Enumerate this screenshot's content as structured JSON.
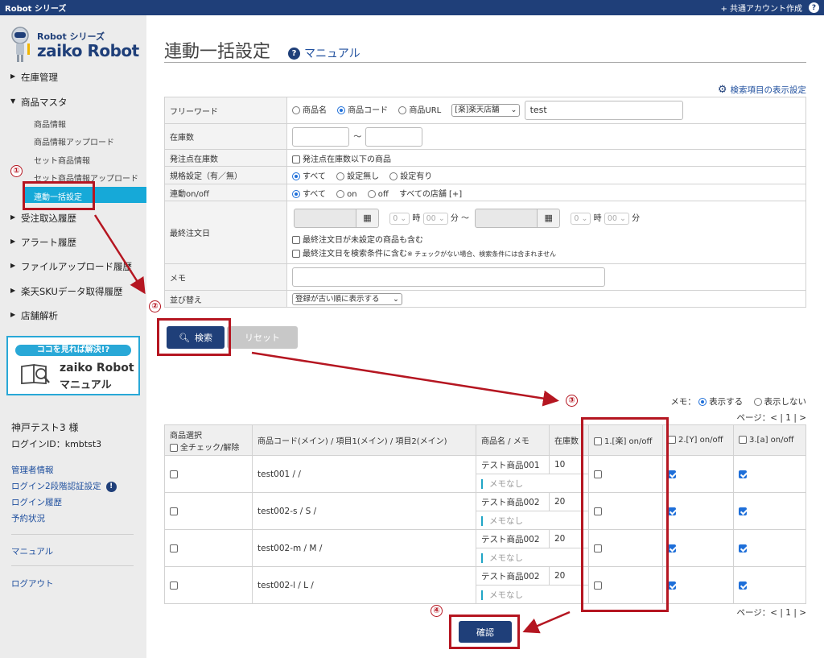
{
  "topbar": {
    "brand": "Robot シリーズ",
    "add_account": "+ 共通アカウント作成",
    "help": "?"
  },
  "sidebar": {
    "logo_series": "Robot シリーズ",
    "logo_name": "zaiko Robot",
    "nav": [
      "在庫管理",
      "商品マスタ",
      "受注取込履歴",
      "アラート履歴",
      "ファイルアップロード履歴",
      "楽天SKUデータ取得履歴",
      "店舗解析"
    ],
    "sub": [
      "商品情報",
      "商品情報アップロード",
      "セット商品情報",
      "セット商品情報アップロード",
      "連動一括設定"
    ],
    "banner_pill": "ココを見れば解決!?",
    "banner_t1": "zaiko Robot",
    "banner_t2": "マニュアル",
    "user": "神戸テスト3 様",
    "login_id": "ログインID：kmbtst3",
    "links": [
      "管理者情報",
      "ログイン2段階認証設定",
      "ログイン履歴",
      "予約状況",
      "マニュアル",
      "ログアウト"
    ]
  },
  "page": {
    "title": "連動一括設定",
    "manual": "マニュアル",
    "display_settings": "検索項目の表示設定"
  },
  "search": {
    "freeword_label": "フリーワード",
    "freeword_opts": [
      "商品名",
      "商品コード",
      "商品URL"
    ],
    "store_select": "[楽]楽天店舗",
    "freeword_value": "test",
    "stock_label": "在庫数",
    "tilde": "〜",
    "reorder_label": "発注点在庫数",
    "reorder_cb": "発注点在庫数以下の商品",
    "spec_label": "規格設定（有／無）",
    "spec_opts": [
      "すべて",
      "設定無し",
      "設定有り"
    ],
    "link_label": "連動on/off",
    "link_opts": [
      "すべて",
      "on",
      "off"
    ],
    "link_stores": "すべての店舗 [+]",
    "lastorder_label": "最終注文日",
    "hour_val": "0",
    "min_val": "00",
    "hour_unit": "時",
    "min_unit": "分",
    "min_unit_tilde": "分 〜",
    "cb1": "最終注文日が未設定の商品も含む",
    "cb2": "最終注文日を検索条件に含む",
    "cb2_note": "※ チェックがない場合、検索条件には含まれません",
    "memo_label": "メモ",
    "sort_label": "並び替え",
    "sort_value": "登録が古い順に表示する"
  },
  "buttons": {
    "search": "検索",
    "reset": "リセット",
    "confirm": "確認"
  },
  "results": {
    "memo_toggle_label": "メモ：",
    "memo_show": "表示する",
    "memo_hide": "表示しない",
    "pager": "ページ：< | 1 | >",
    "headers": {
      "select": "商品選択",
      "select_all": "全チェック/解除",
      "code": "商品コード(メイン) / 項目1(メイン) / 項目2(メイン)",
      "name": "商品名 / メモ",
      "stock": "在庫数",
      "col1": "1.[楽] on/off",
      "col2": "2.[Y] on/off",
      "col3": "3.[a] on/off"
    },
    "rows": [
      {
        "code": "test001 / /",
        "name": "テスト商品001",
        "stock": "10",
        "memo": "メモなし"
      },
      {
        "code": "test002-s / S /",
        "name": "テスト商品002",
        "stock": "20",
        "memo": "メモなし"
      },
      {
        "code": "test002-m / M /",
        "name": "テスト商品002",
        "stock": "20",
        "memo": "メモなし"
      },
      {
        "code": "test002-l / L /",
        "name": "テスト商品002",
        "stock": "20",
        "memo": "メモなし"
      }
    ]
  },
  "annotations": [
    "①",
    "②",
    "③",
    "④"
  ],
  "colors": {
    "navy": "#1f3f79",
    "accent": "#16a9d8",
    "highlight": "#b51621"
  }
}
